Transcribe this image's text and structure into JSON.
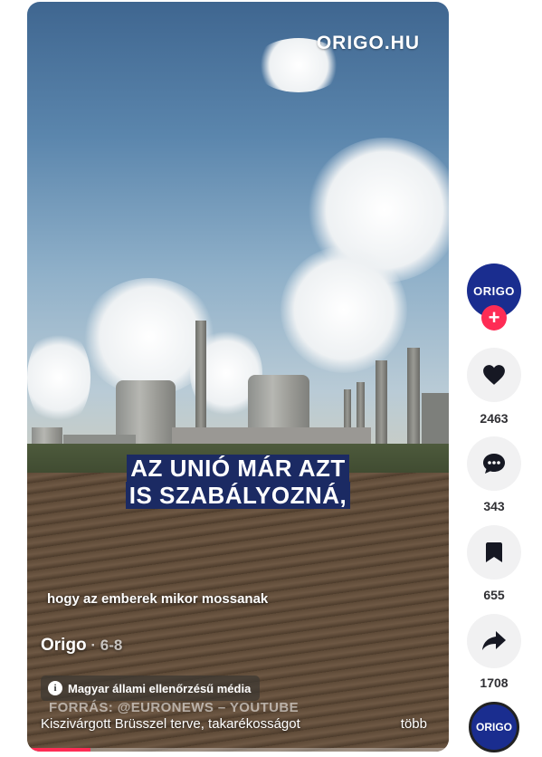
{
  "video": {
    "watermark": "ORIGO.HU",
    "caption_lines": [
      "AZ UNIÓ MÁR AZT",
      "IS SZABÁLYOZNÁ,"
    ],
    "subtitle": "hogy az emberek mikor mossanak",
    "author": "Origo",
    "date": " · 6-8",
    "badge_text": "Magyar állami ellenőrzésű média",
    "source_text": "FORRÁS: @EURONEWS – YOUTUBE",
    "description": "Kiszivárgott Brüsszel terve, takarékosságot",
    "more_label": "több",
    "progress": 0.15
  },
  "actions": {
    "avatar_label": "ORIGO",
    "follow_label": "+",
    "likes": "2463",
    "comments": "343",
    "saves": "655",
    "shares": "1708",
    "sound_label": "ORIGO",
    "icons": [
      "heart-icon",
      "comment-icon",
      "bookmark-icon",
      "share-icon"
    ]
  },
  "colors": {
    "accent": "#fe2c55",
    "brand": "#1a2d8f",
    "caption_bg": "#1b2a63"
  }
}
